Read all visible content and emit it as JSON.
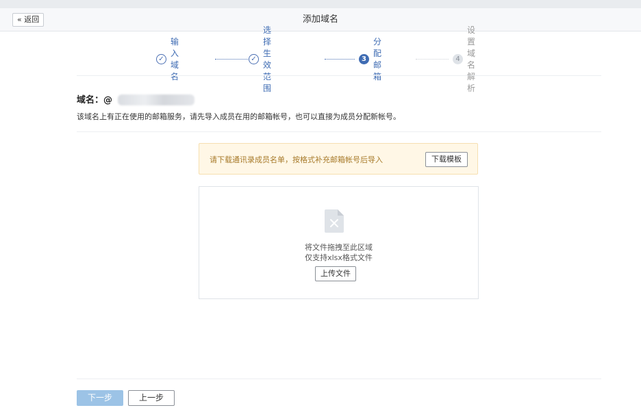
{
  "header": {
    "back_label": "« 返回",
    "title": "添加域名"
  },
  "steps": [
    {
      "label": "输入域名",
      "state": "done",
      "number": "✓"
    },
    {
      "label": "选择生效范围",
      "state": "done",
      "number": "✓"
    },
    {
      "label": "分配邮箱",
      "state": "active",
      "number": "3"
    },
    {
      "label": "设置域名解析",
      "state": "todo",
      "number": "4"
    }
  ],
  "domain": {
    "label": "域名：@",
    "description": "该域名上有正在使用的邮箱服务，请先导入成员在用的邮箱帐号，也可以直接为成员分配新帐号。"
  },
  "notice": {
    "text": "请下载通讯录成员名单，按格式补充邮箱帐号后导入",
    "button_label": "下载模板"
  },
  "dropzone": {
    "hint_line1": "将文件拖拽至此区域",
    "hint_line2": "仅支持xlsx格式文件",
    "upload_label": "上传文件",
    "icon": "file-x-icon"
  },
  "footer": {
    "next_label": "下一步",
    "prev_label": "上一步"
  },
  "colors": {
    "accent": "#3f6cb3",
    "notice_bg": "#fff7e6",
    "notice_text": "#a77a2a",
    "next_disabled": "#9cc3e6"
  }
}
